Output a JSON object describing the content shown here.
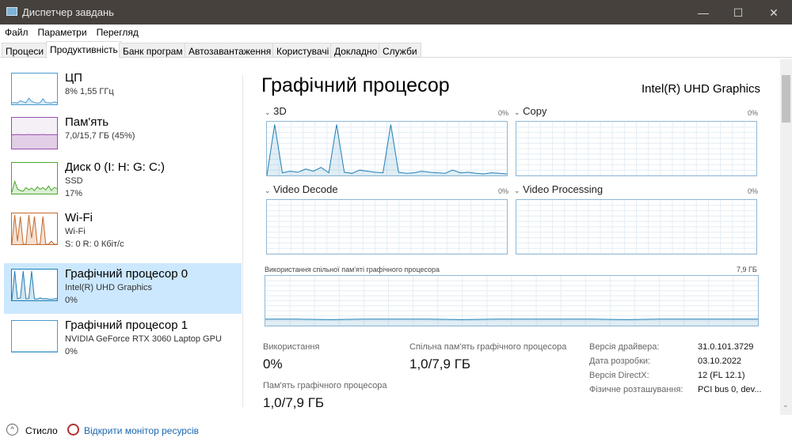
{
  "window": {
    "title": "Диспетчер завдань",
    "minimize": "—",
    "maximize": "☐",
    "close": "✕"
  },
  "menu": [
    "Файл",
    "Параметри",
    "Перегляд"
  ],
  "tabs": [
    "Процеси",
    "Продуктивність",
    "Банк програм",
    "Автозавантаження",
    "Користувачі",
    "Докладно",
    "Служби"
  ],
  "sidebar": [
    {
      "title": "ЦП",
      "line2": "8% 1,55 ГГц",
      "line3": "",
      "color": "#4a9bd1",
      "bg": "#fff",
      "series": [
        5,
        6,
        4,
        12,
        8,
        5,
        20,
        10,
        6,
        4,
        5,
        18,
        6,
        5,
        4,
        8,
        6
      ]
    },
    {
      "title": "Пам'ять",
      "line2": "7,0/15,7 ГБ (45%)",
      "line3": "",
      "color": "#9b4bb0",
      "bg": "#f4f0f6",
      "series": [
        45,
        45,
        46,
        45,
        45,
        45,
        46,
        45,
        45,
        45,
        45,
        46,
        45,
        45,
        45,
        45,
        45
      ]
    },
    {
      "title": "Диск 0 (I: H: G: C:)",
      "line2": "SSD",
      "line3": "17%",
      "color": "#4ca82c",
      "bg": "#fff",
      "series": [
        5,
        40,
        15,
        10,
        8,
        20,
        12,
        18,
        10,
        22,
        14,
        20,
        12,
        25,
        10,
        20,
        17
      ]
    },
    {
      "title": "Wi-Fi",
      "line2": "Wi-Fi",
      "line3": "S: 0 R: 0 Кбіт/с",
      "color": "#c46a2a",
      "bg": "#fff",
      "series": [
        0,
        95,
        10,
        90,
        0,
        0,
        95,
        20,
        90,
        0,
        0,
        90,
        0,
        0,
        10,
        0,
        0
      ]
    },
    {
      "title": "Графічний процесор 0",
      "line2": "Intel(R) UHD Graphics",
      "line3": "0%",
      "color": "#1f7fb5",
      "bg": "#fff",
      "series": [
        0,
        95,
        5,
        8,
        95,
        5,
        6,
        95,
        5,
        4,
        8,
        5,
        6,
        4,
        3,
        5,
        6
      ]
    },
    {
      "title": "Графічний процесор 1",
      "line2": "NVIDIA GeForce RTX 3060 Laptop GPU",
      "line3": "0%",
      "color": "#4a9bd1",
      "bg": "#fff",
      "series": [
        0,
        0,
        0,
        0,
        0,
        0,
        0,
        0,
        0,
        0,
        0,
        0,
        0,
        0,
        0,
        0,
        0
      ]
    }
  ],
  "main": {
    "title": "Графічний процесор",
    "device": "Intel(R) UHD Graphics",
    "graphs": [
      {
        "label": "3D",
        "pct": "0%",
        "series": [
          0,
          95,
          5,
          8,
          6,
          12,
          8,
          15,
          5,
          95,
          6,
          4,
          10,
          8,
          6,
          5,
          95,
          6,
          4,
          5,
          8,
          6,
          5,
          4,
          10,
          5,
          6,
          4,
          3,
          5,
          4,
          3
        ]
      },
      {
        "label": "Copy",
        "pct": "0%",
        "series": []
      },
      {
        "label": "Video Decode",
        "pct": "0%",
        "series": []
      },
      {
        "label": "Video Processing",
        "pct": "0%",
        "series": []
      }
    ],
    "shared_graph": {
      "label": "Використання спільної пам'яті графічного процесора",
      "max": "7,9 ГБ",
      "series": [
        13,
        13,
        12,
        13,
        13,
        13,
        12,
        13,
        13,
        13,
        13,
        12,
        13,
        13,
        13,
        13
      ]
    },
    "stats": {
      "usage_label": "Використання",
      "usage": "0%",
      "shared_label": "Спільна пам'ять графічного процесора",
      "shared": "1,0/7,9 ГБ",
      "mem_label": "Пам'ять графічного процесора",
      "mem": "1,0/7,9 ГБ"
    },
    "info": [
      {
        "k": "Версія драйвера:",
        "v": "31.0.101.3729"
      },
      {
        "k": "Дата розробки:",
        "v": "03.10.2022"
      },
      {
        "k": "Версія DirectX:",
        "v": "12 (FL 12.1)"
      },
      {
        "k": "Фізичне розташування:",
        "v": "PCI bus 0, dev..."
      }
    ]
  },
  "footer": {
    "less": "Стисло",
    "monitor": "Відкрити монітор ресурсів"
  }
}
